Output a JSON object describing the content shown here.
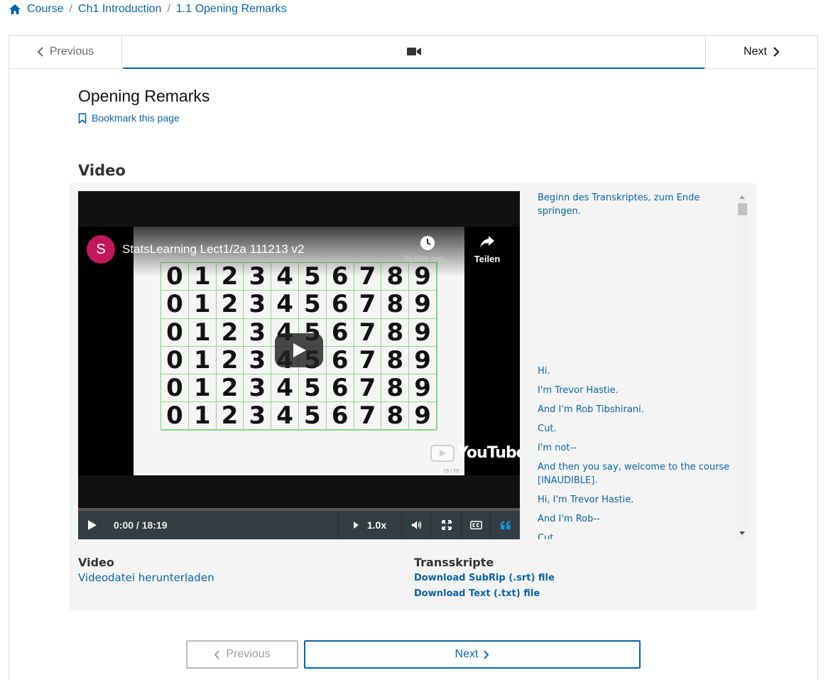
{
  "breadcrumb": {
    "items": [
      "Course",
      "Ch1 Introduction",
      "1.1 Opening Remarks"
    ],
    "separator": "/"
  },
  "sequence_nav": {
    "previous_label": "Previous",
    "next_label": "Next",
    "active_tab_icon": "video-camera-icon"
  },
  "unit": {
    "title": "Opening Remarks",
    "bookmark_label": "Bookmark this page"
  },
  "video_section": {
    "heading": "Video",
    "player": {
      "channel_initial": "S",
      "title": "StatsLearning Lect1/2a 111213 v2",
      "watch_later_label": "Später ans...",
      "share_label": "Teilen",
      "youtube_wordmark": "YouTube",
      "slide_counter": "15 / 29",
      "time": "0:00 / 18:19",
      "speed": "1.0x",
      "progress_fraction": 0.004,
      "digit_rows": [
        [
          "0",
          "1",
          "2",
          "3",
          "4",
          "5",
          "6",
          "7",
          "8",
          "9"
        ],
        [
          "0",
          "1",
          "2",
          "3",
          "4",
          "5",
          "6",
          "7",
          "8",
          "9"
        ],
        [
          "0",
          "1",
          "2",
          "3",
          "4",
          "5",
          "6",
          "7",
          "8",
          "9"
        ],
        [
          "0",
          "1",
          "2",
          "3",
          "4",
          "5",
          "6",
          "7",
          "8",
          "9"
        ],
        [
          "0",
          "1",
          "2",
          "3",
          "4",
          "5",
          "6",
          "7",
          "8",
          "9"
        ],
        [
          "0",
          "1",
          "2",
          "3",
          "4",
          "5",
          "6",
          "7",
          "8",
          "9"
        ]
      ]
    },
    "transcript": {
      "start_link": "Beginn des Transkriptes, zum Ende springen.",
      "lines": [
        "Hi.",
        "I'm Trevor Hastie.",
        "And I'm Rob Tibshirani.",
        "Cut.",
        "I'm not--",
        "And then you say, welcome to the course [INAUDIBLE].",
        "Hi, I'm Trevor Hastie.",
        "And I'm Rob--",
        "Cut."
      ]
    },
    "downloads": {
      "video_heading": "Video",
      "video_link": "Videodatei herunterladen",
      "transcripts_heading": "Transskripte",
      "srt_link": "Download SubRip (.srt) file",
      "txt_link": "Download Text (.txt) file"
    }
  },
  "bottom_nav": {
    "previous_label": "Previous",
    "next_label": "Next"
  },
  "colors": {
    "link": "#0a64a4",
    "channel_avatar": "#c2185b",
    "progress": "#cc1f5b",
    "control_bar": "#323d44"
  }
}
